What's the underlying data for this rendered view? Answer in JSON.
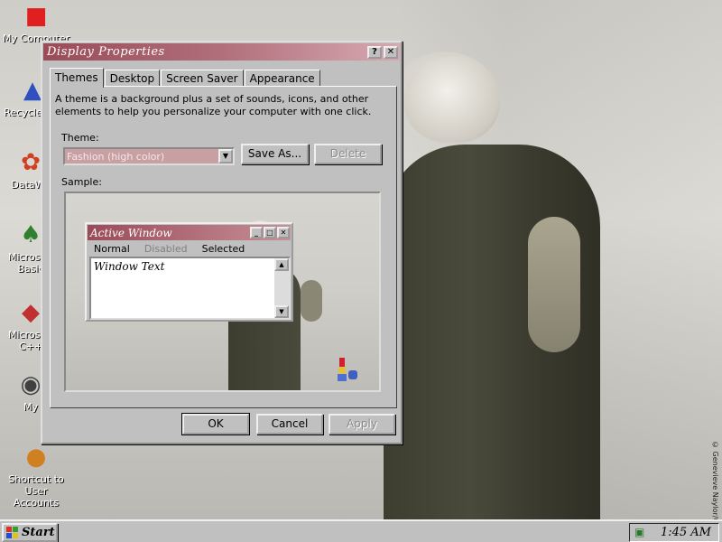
{
  "desktop": {
    "icons": [
      {
        "label": "My Computer",
        "icon": "computer-icon"
      },
      {
        "label": "Recycle Bin",
        "icon": "recycle-bin-icon"
      },
      {
        "label": "DataWa",
        "icon": "shortcut-icon"
      },
      {
        "label": "Microsoft Basic",
        "icon": "shortcut-icon"
      },
      {
        "label": "Microsoft C++",
        "icon": "shortcut-icon"
      },
      {
        "label": "My",
        "icon": "shortcut-icon"
      },
      {
        "label": "Shortcut to User Accounts",
        "icon": "users-icon"
      }
    ],
    "wallpaper_credit": "© Genevieve Naylor/Cor"
  },
  "dialog": {
    "title": "Display Properties",
    "help_button": "?",
    "close_button": "✕",
    "tabs": [
      "Themes",
      "Desktop",
      "Screen Saver",
      "Appearance"
    ],
    "active_tab": "Themes",
    "description": "A theme is a background plus a set of sounds, icons, and other elements to help you personalize your computer with one click.",
    "theme_label": "Theme:",
    "theme_value": "Fashion (high color)",
    "save_as": "Save As...",
    "delete": "Delete",
    "sample_label": "Sample:",
    "preview": {
      "title": "Active Window",
      "menu": [
        "Normal",
        "Disabled",
        "Selected"
      ],
      "text": "Window Text"
    },
    "ok": "OK",
    "cancel": "Cancel",
    "apply": "Apply"
  },
  "taskbar": {
    "start": "Start",
    "clock": "1:45 AM"
  },
  "colors": {
    "title_bar": "#9a4b58",
    "combo": "#c8a0a3",
    "face": "#c0c0c0"
  }
}
